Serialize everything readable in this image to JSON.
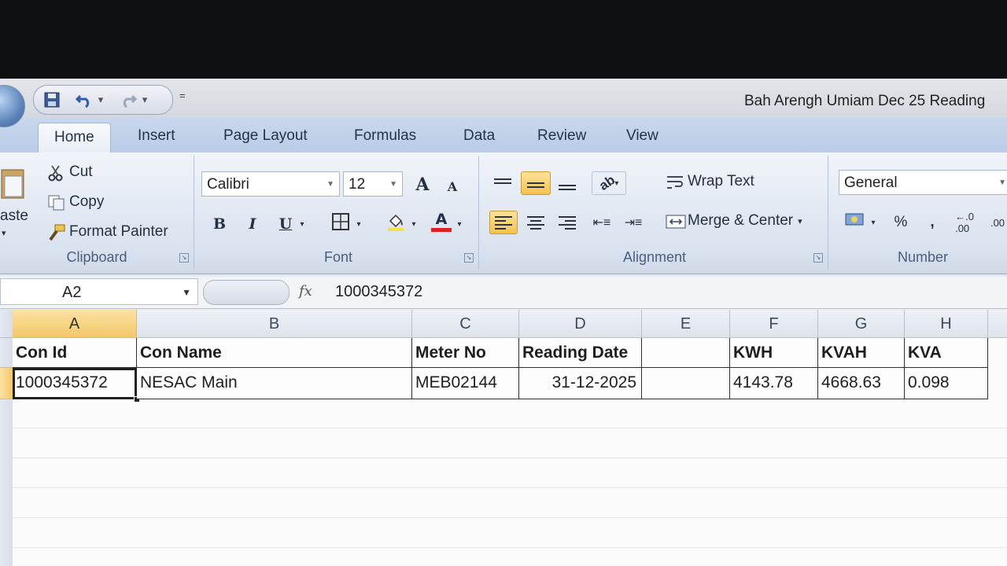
{
  "window": {
    "title": "Bah Arengh Umiam Dec 25 Reading",
    "qat": {
      "save_icon": "save-icon",
      "undo_icon": "undo-icon",
      "redo_icon": "redo-icon",
      "customize": "="
    }
  },
  "tabs": [
    {
      "label": "Home"
    },
    {
      "label": "Insert"
    },
    {
      "label": "Page Layout"
    },
    {
      "label": "Formulas"
    },
    {
      "label": "Data"
    },
    {
      "label": "Review"
    },
    {
      "label": "View"
    }
  ],
  "ribbon": {
    "clipboard": {
      "label": "Clipboard",
      "paste": "aste",
      "cut": "Cut",
      "copy": "Copy",
      "format_painter": "Format Painter"
    },
    "font": {
      "label": "Font",
      "family": "Calibri",
      "size": "12",
      "grow": "A",
      "shrink": "A",
      "bold": "B",
      "italic": "I",
      "underline": "U",
      "font_color_bar": "#e02020"
    },
    "alignment": {
      "label": "Alignment",
      "wrap_text": "Wrap Text",
      "merge_center": "Merge & Center"
    },
    "number": {
      "label": "Number",
      "format": "General",
      "percent": "%",
      "comma": ","
    }
  },
  "formula_bar": {
    "name_box": "A2",
    "fx": "fx",
    "value": "1000345372"
  },
  "sheet": {
    "columns": [
      "A",
      "B",
      "C",
      "D",
      "E",
      "F",
      "G",
      "H"
    ],
    "selected_cell": "A2",
    "header_row": [
      "Con Id",
      "Con Name",
      "Meter No",
      "Reading Date",
      "",
      "KWH",
      "KVAH",
      "KVA"
    ],
    "data_row": [
      "1000345372",
      "NESAC Main",
      "MEB02144",
      "31-12-2025",
      "",
      "4143.78",
      "4668.63",
      "0.098"
    ]
  },
  "colors": {
    "accent_selected": "#f3c86a",
    "ribbon_blue": "#b9cde8"
  }
}
